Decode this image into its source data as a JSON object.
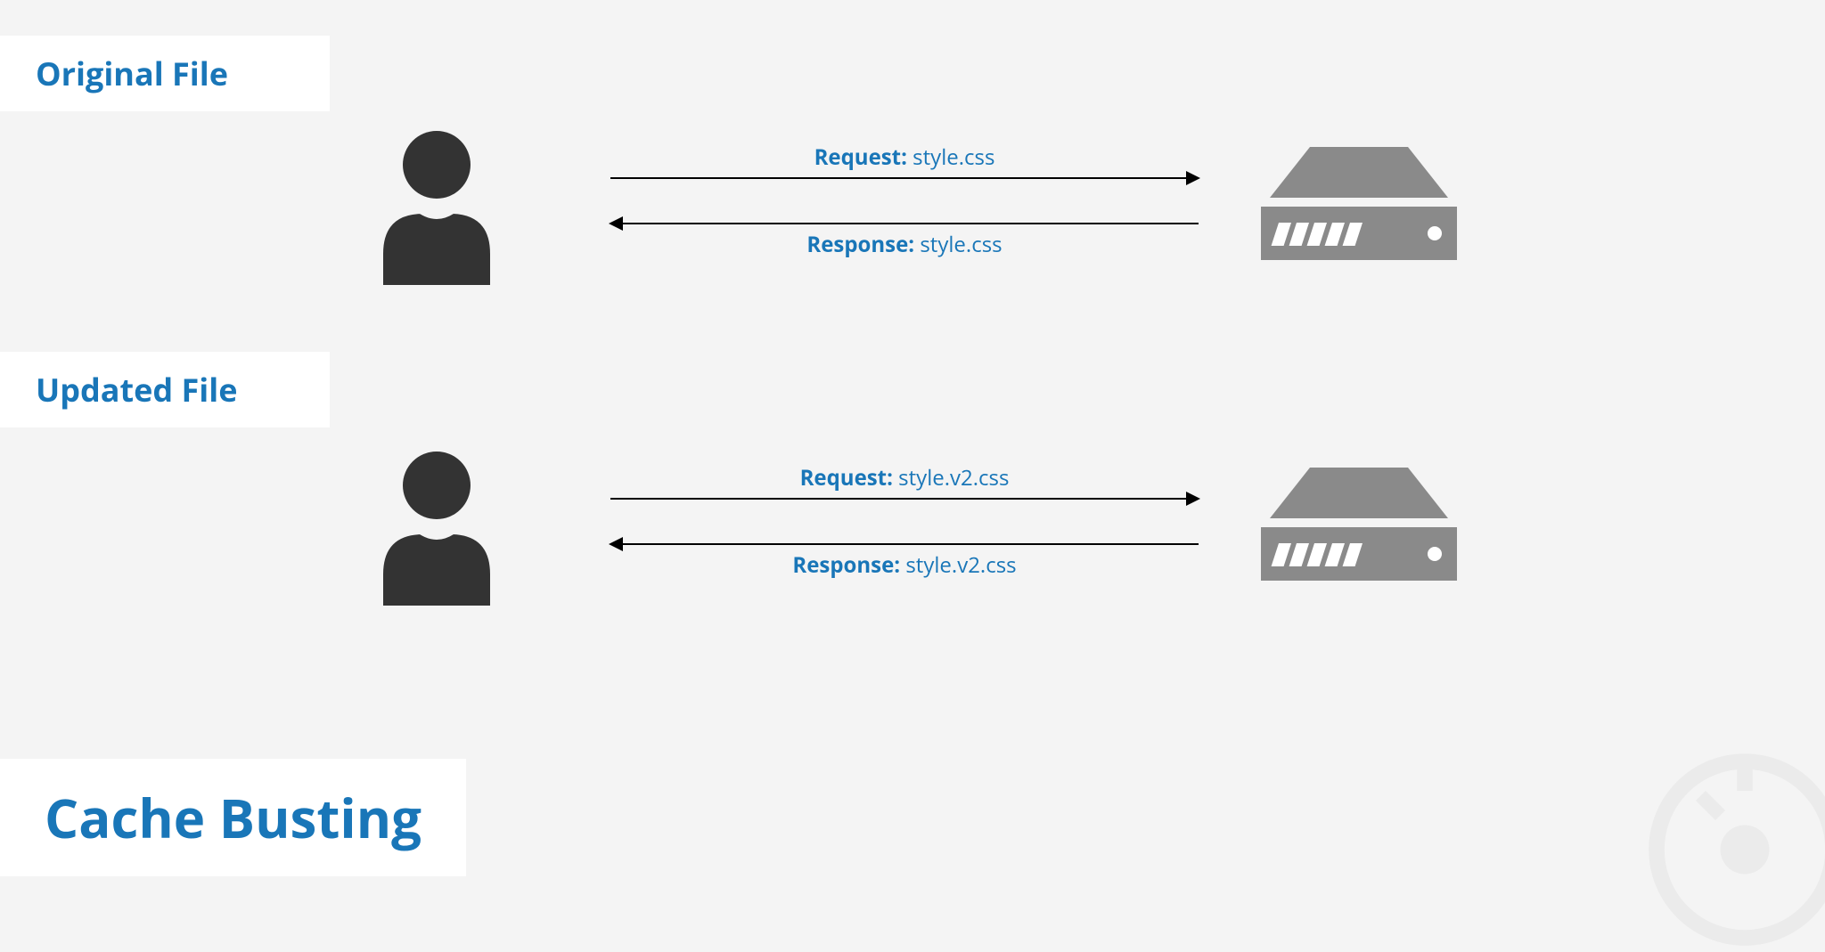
{
  "title": "Cache Busting",
  "sections": {
    "original": {
      "label": "Original File",
      "request_label": "Request:",
      "request_file": "style.css",
      "response_label": "Response:",
      "response_file": "style.css"
    },
    "updated": {
      "label": "Updated File",
      "request_label": "Request:",
      "request_file": "style.v2.css",
      "response_label": "Response:",
      "response_file": "style.v2.css"
    }
  },
  "colors": {
    "accent": "#1976b8",
    "icon": "#333333",
    "server": "#8a8a8a",
    "background": "#f4f4f4"
  }
}
